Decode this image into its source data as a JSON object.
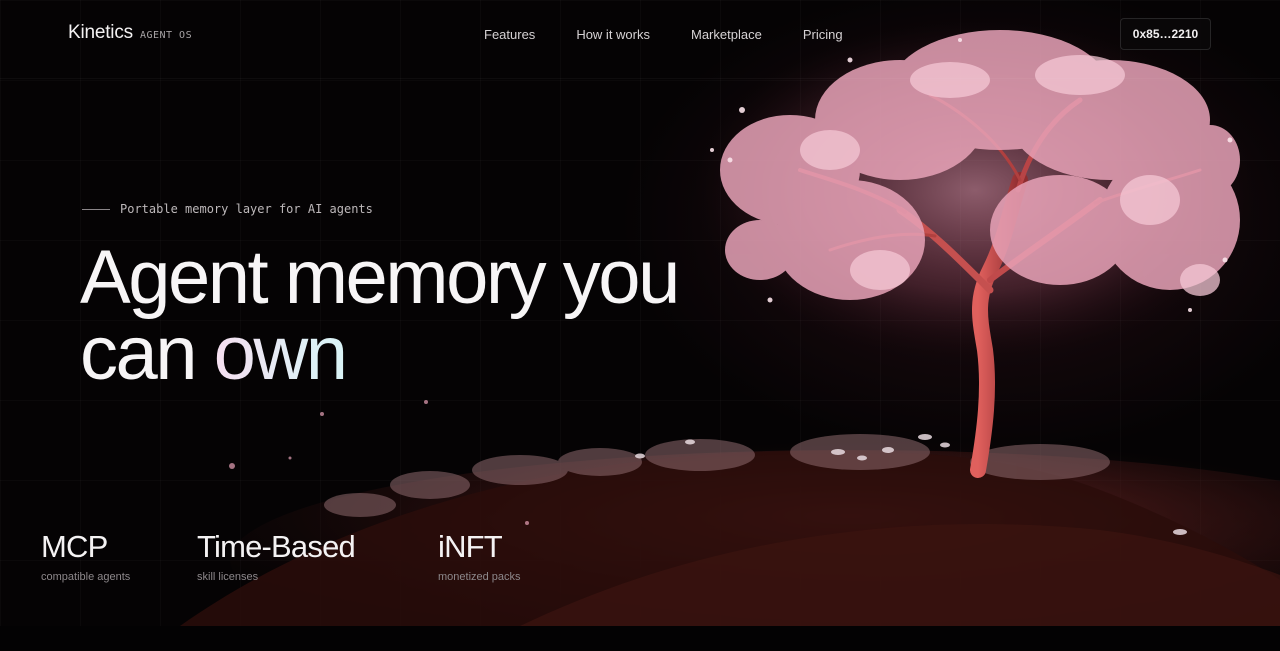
{
  "nav": {
    "brand": "Kinetics",
    "brand_tag": "AGENT OS",
    "links": [
      "Features",
      "How it works",
      "Marketplace",
      "Pricing"
    ],
    "wallet": "0x85…2210"
  },
  "hero": {
    "eyebrow": "Portable memory layer for AI agents",
    "headline_line1": "Agent memory you",
    "headline_line2_plain": "can ",
    "headline_line2_accent": "own"
  },
  "stats": [
    {
      "value": "MCP",
      "label": "compatible agents"
    },
    {
      "value": "Time-Based",
      "label": "skill licenses"
    },
    {
      "value": "iNFT",
      "label": "monetized packs"
    }
  ],
  "colors": {
    "background": "#050304",
    "blossom": "#e8a3b8",
    "trunk": "#c84a4a"
  }
}
